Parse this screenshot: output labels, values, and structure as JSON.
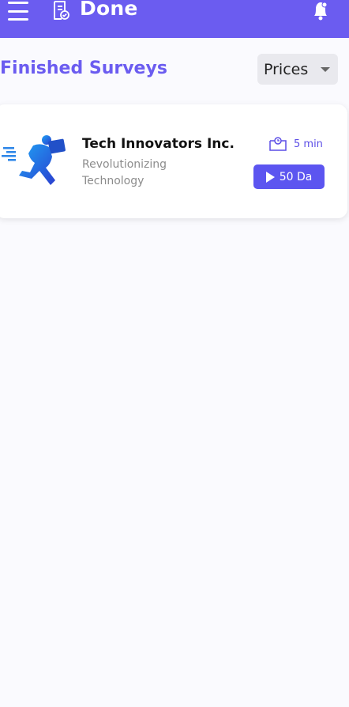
{
  "colors": {
    "header_bg": "#6B5CF0",
    "accent": "#6B5CF0",
    "page_bg": "#FAFAFE",
    "price_button_bg": "#5C55F0"
  },
  "header": {
    "title": "Done",
    "menu_icon": "hamburger-menu-icon",
    "title_icon": "clipboard-check-icon",
    "notification_icon": "bell-icon"
  },
  "section": {
    "title": "Finished Surveys",
    "sort": {
      "selected": "Prices",
      "icon": "caret-down-icon"
    }
  },
  "surveys": [
    {
      "company": "Tech Innovators Inc.",
      "description": "Revolutionizing Technology",
      "duration": "5 min",
      "duration_icon": "clock-icon",
      "price": "50 Da",
      "price_icon": "play-icon",
      "logo": "courier-runner-logo"
    }
  ]
}
